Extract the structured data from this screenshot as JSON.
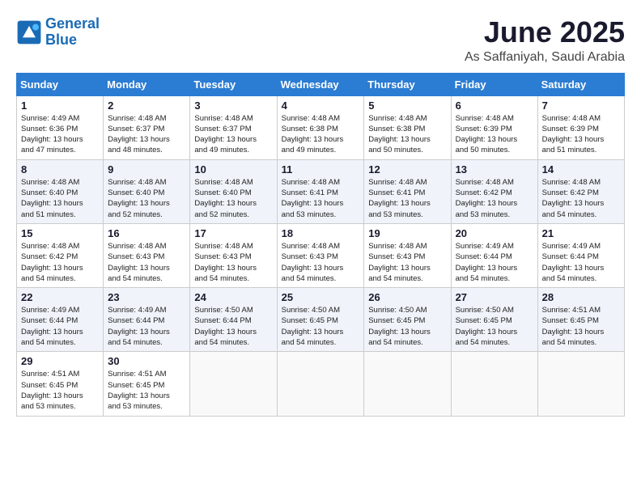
{
  "header": {
    "logo_line1": "General",
    "logo_line2": "Blue",
    "month": "June 2025",
    "location": "As Saffaniyah, Saudi Arabia"
  },
  "weekdays": [
    "Sunday",
    "Monday",
    "Tuesday",
    "Wednesday",
    "Thursday",
    "Friday",
    "Saturday"
  ],
  "weeks": [
    [
      {
        "day": "1",
        "info": "Sunrise: 4:49 AM\nSunset: 6:36 PM\nDaylight: 13 hours\nand 47 minutes."
      },
      {
        "day": "2",
        "info": "Sunrise: 4:48 AM\nSunset: 6:37 PM\nDaylight: 13 hours\nand 48 minutes."
      },
      {
        "day": "3",
        "info": "Sunrise: 4:48 AM\nSunset: 6:37 PM\nDaylight: 13 hours\nand 49 minutes."
      },
      {
        "day": "4",
        "info": "Sunrise: 4:48 AM\nSunset: 6:38 PM\nDaylight: 13 hours\nand 49 minutes."
      },
      {
        "day": "5",
        "info": "Sunrise: 4:48 AM\nSunset: 6:38 PM\nDaylight: 13 hours\nand 50 minutes."
      },
      {
        "day": "6",
        "info": "Sunrise: 4:48 AM\nSunset: 6:39 PM\nDaylight: 13 hours\nand 50 minutes."
      },
      {
        "day": "7",
        "info": "Sunrise: 4:48 AM\nSunset: 6:39 PM\nDaylight: 13 hours\nand 51 minutes."
      }
    ],
    [
      {
        "day": "8",
        "info": "Sunrise: 4:48 AM\nSunset: 6:40 PM\nDaylight: 13 hours\nand 51 minutes."
      },
      {
        "day": "9",
        "info": "Sunrise: 4:48 AM\nSunset: 6:40 PM\nDaylight: 13 hours\nand 52 minutes."
      },
      {
        "day": "10",
        "info": "Sunrise: 4:48 AM\nSunset: 6:40 PM\nDaylight: 13 hours\nand 52 minutes."
      },
      {
        "day": "11",
        "info": "Sunrise: 4:48 AM\nSunset: 6:41 PM\nDaylight: 13 hours\nand 53 minutes."
      },
      {
        "day": "12",
        "info": "Sunrise: 4:48 AM\nSunset: 6:41 PM\nDaylight: 13 hours\nand 53 minutes."
      },
      {
        "day": "13",
        "info": "Sunrise: 4:48 AM\nSunset: 6:42 PM\nDaylight: 13 hours\nand 53 minutes."
      },
      {
        "day": "14",
        "info": "Sunrise: 4:48 AM\nSunset: 6:42 PM\nDaylight: 13 hours\nand 54 minutes."
      }
    ],
    [
      {
        "day": "15",
        "info": "Sunrise: 4:48 AM\nSunset: 6:42 PM\nDaylight: 13 hours\nand 54 minutes."
      },
      {
        "day": "16",
        "info": "Sunrise: 4:48 AM\nSunset: 6:43 PM\nDaylight: 13 hours\nand 54 minutes."
      },
      {
        "day": "17",
        "info": "Sunrise: 4:48 AM\nSunset: 6:43 PM\nDaylight: 13 hours\nand 54 minutes."
      },
      {
        "day": "18",
        "info": "Sunrise: 4:48 AM\nSunset: 6:43 PM\nDaylight: 13 hours\nand 54 minutes."
      },
      {
        "day": "19",
        "info": "Sunrise: 4:48 AM\nSunset: 6:43 PM\nDaylight: 13 hours\nand 54 minutes."
      },
      {
        "day": "20",
        "info": "Sunrise: 4:49 AM\nSunset: 6:44 PM\nDaylight: 13 hours\nand 54 minutes."
      },
      {
        "day": "21",
        "info": "Sunrise: 4:49 AM\nSunset: 6:44 PM\nDaylight: 13 hours\nand 54 minutes."
      }
    ],
    [
      {
        "day": "22",
        "info": "Sunrise: 4:49 AM\nSunset: 6:44 PM\nDaylight: 13 hours\nand 54 minutes."
      },
      {
        "day": "23",
        "info": "Sunrise: 4:49 AM\nSunset: 6:44 PM\nDaylight: 13 hours\nand 54 minutes."
      },
      {
        "day": "24",
        "info": "Sunrise: 4:50 AM\nSunset: 6:44 PM\nDaylight: 13 hours\nand 54 minutes."
      },
      {
        "day": "25",
        "info": "Sunrise: 4:50 AM\nSunset: 6:45 PM\nDaylight: 13 hours\nand 54 minutes."
      },
      {
        "day": "26",
        "info": "Sunrise: 4:50 AM\nSunset: 6:45 PM\nDaylight: 13 hours\nand 54 minutes."
      },
      {
        "day": "27",
        "info": "Sunrise: 4:50 AM\nSunset: 6:45 PM\nDaylight: 13 hours\nand 54 minutes."
      },
      {
        "day": "28",
        "info": "Sunrise: 4:51 AM\nSunset: 6:45 PM\nDaylight: 13 hours\nand 54 minutes."
      }
    ],
    [
      {
        "day": "29",
        "info": "Sunrise: 4:51 AM\nSunset: 6:45 PM\nDaylight: 13 hours\nand 53 minutes."
      },
      {
        "day": "30",
        "info": "Sunrise: 4:51 AM\nSunset: 6:45 PM\nDaylight: 13 hours\nand 53 minutes."
      },
      {
        "day": "",
        "info": ""
      },
      {
        "day": "",
        "info": ""
      },
      {
        "day": "",
        "info": ""
      },
      {
        "day": "",
        "info": ""
      },
      {
        "day": "",
        "info": ""
      }
    ]
  ]
}
